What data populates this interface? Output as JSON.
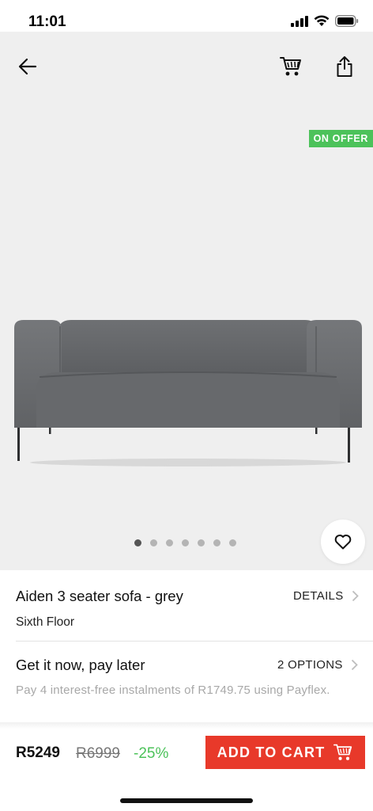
{
  "status": {
    "time": "11:01"
  },
  "hero": {
    "badge": "ON OFFER",
    "slides_total": 7,
    "active_slide": 1
  },
  "product": {
    "title": "Aiden 3 seater sofa - grey",
    "details_label": "DETAILS",
    "brand": "Sixth Floor"
  },
  "paylater": {
    "title": "Get it now, pay later",
    "options_label": "2 OPTIONS",
    "description": "Pay 4 interest-free instalments of R1749.75 using Payflex."
  },
  "pricing": {
    "current": "R5249",
    "original": "R6999",
    "discount": "-25%",
    "add_to_cart_label": "ADD TO CART"
  },
  "icons": [
    "back-arrow-icon",
    "cart-icon",
    "share-icon",
    "heart-icon",
    "chevron-right-icon"
  ],
  "colors": {
    "accent": "#e8392a",
    "offer": "#4cc25a"
  }
}
